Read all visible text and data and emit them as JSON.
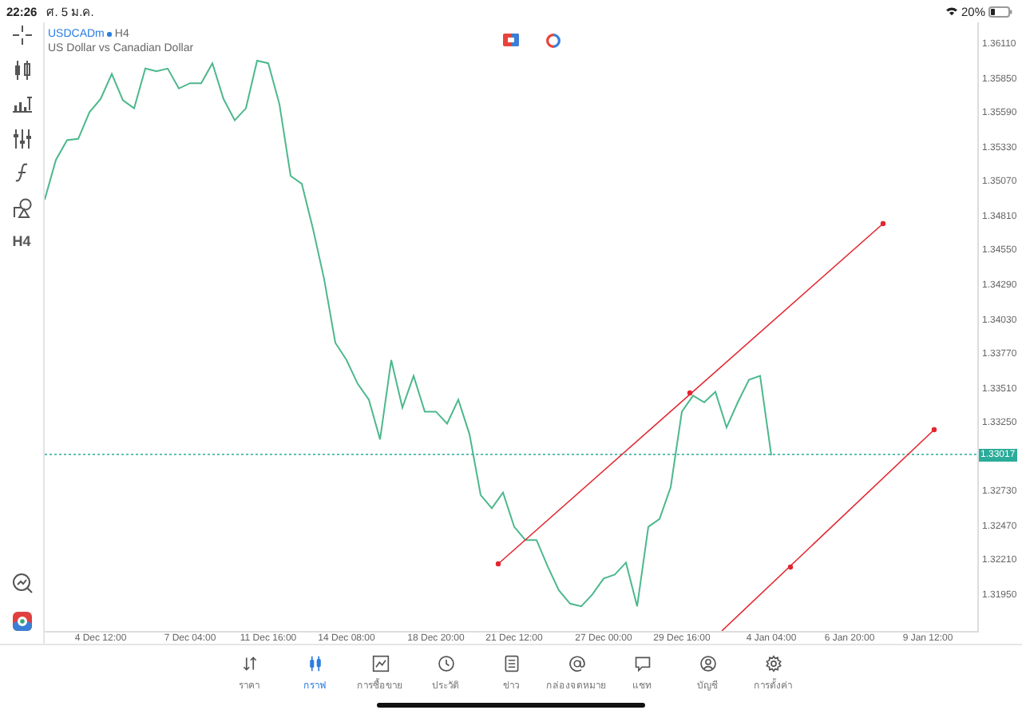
{
  "status_bar": {
    "time": "22:26",
    "date": "ศ. 5 ม.ค.",
    "battery": "20%"
  },
  "toolbar": {
    "timeframe": "H4"
  },
  "chart": {
    "timeframe": "H4",
    "current_price": "1.33017",
    "description": "US Dollar vs Canadian Dollar",
    "chart_data": {
      "type": "line",
      "ylim": [
        1.31684,
        1.36279
      ],
      "categories": [
        null,
        null,
        null,
        null,
        null,
        "4 Dec 12:00",
        null,
        null,
        null,
        null,
        null,
        null,
        null,
        "7 Dec 04:00",
        null,
        null,
        null,
        null,
        null,
        null,
        "11 Dec 16:00",
        null,
        null,
        null,
        null,
        null,
        null,
        "14 Dec 08:00",
        null,
        null,
        null,
        null,
        null,
        null,
        null,
        "18 Dec 20:00",
        null,
        null,
        null,
        null,
        null,
        null,
        "21 Dec 12:00",
        null,
        null,
        null,
        null,
        null,
        null,
        null,
        "27 Dec 00:00",
        null,
        null,
        null,
        null,
        null,
        null,
        "29 Dec 16:00",
        null,
        null,
        null,
        null,
        null,
        null,
        null,
        "4 Jan 04:00",
        null,
        null,
        null,
        null,
        null,
        null,
        "6 Jan 20:00",
        null,
        null,
        null,
        null,
        null,
        null,
        "9 Jan 12:00",
        null,
        null,
        null,
        null
      ],
      "yticks": [
        {
          "value": 1.3611,
          "label": "1.36110"
        },
        {
          "value": 1.3585,
          "label": "1.35850"
        },
        {
          "value": 1.3559,
          "label": "1.35590"
        },
        {
          "value": 1.3533,
          "label": "1.35330"
        },
        {
          "value": 1.3507,
          "label": "1.35070"
        },
        {
          "value": 1.3481,
          "label": "1.34810"
        },
        {
          "value": 1.3455,
          "label": "1.34550"
        },
        {
          "value": 1.3429,
          "label": "1.34290"
        },
        {
          "value": 1.3403,
          "label": "1.34030"
        },
        {
          "value": 1.3377,
          "label": "1.33770"
        },
        {
          "value": 1.3351,
          "label": "1.33510"
        },
        {
          "value": 1.3325,
          "label": "1.33250"
        },
        {
          "value": 1.3273,
          "label": "1.32730"
        },
        {
          "value": 1.3247,
          "label": "1.32470"
        },
        {
          "value": 1.3221,
          "label": "1.32210"
        },
        {
          "value": 1.3195,
          "label": "1.31950"
        }
      ],
      "series": [
        {
          "name": "USDCADm",
          "color": "#4cb88c",
          "values": [
            1.3494,
            1.3524,
            1.3539,
            1.354,
            1.356,
            1.357,
            1.3589,
            1.3569,
            1.3563,
            1.3593,
            1.3591,
            1.3593,
            1.3578,
            1.3582,
            1.3582,
            1.3597,
            1.357,
            1.3554,
            1.3563,
            1.3599,
            1.3597,
            1.3566,
            1.3512,
            1.3506,
            1.3472,
            1.3434,
            1.3386,
            1.3373,
            1.3355,
            1.3343,
            1.3313,
            1.3373,
            1.3337,
            1.3361,
            1.3334,
            1.3334,
            1.3325,
            1.3343,
            1.3317,
            1.3271,
            1.3261,
            1.3273,
            1.3247,
            1.3237,
            1.3237,
            1.3217,
            1.3199,
            1.3189,
            1.3187,
            1.3196,
            1.3208,
            1.3211,
            1.322,
            1.3187,
            1.3247,
            1.3253,
            1.3277,
            1.3334,
            1.3346,
            1.3341,
            1.3349,
            1.3322,
            1.3341,
            1.3358,
            1.3361,
            1.3301,
            null,
            null,
            null,
            null,
            null,
            null,
            null,
            null,
            null,
            null,
            null,
            null,
            null,
            null,
            null,
            null,
            null,
            null
          ]
        }
      ]
    }
  },
  "tabs": [
    {
      "label": "ราคา",
      "selected": false
    },
    {
      "label": "กราฟ",
      "selected": true
    },
    {
      "label": "การซื้อขาย",
      "selected": false
    },
    {
      "label": "ประวัติ",
      "selected": false
    },
    {
      "label": "ข่าว",
      "selected": false
    },
    {
      "label": "กล่องจดหมาย",
      "selected": false
    },
    {
      "label": "แชท",
      "selected": false
    },
    {
      "label": "บัญชี",
      "selected": false
    },
    {
      "label": "การตั้งค่า",
      "selected": false
    }
  ]
}
